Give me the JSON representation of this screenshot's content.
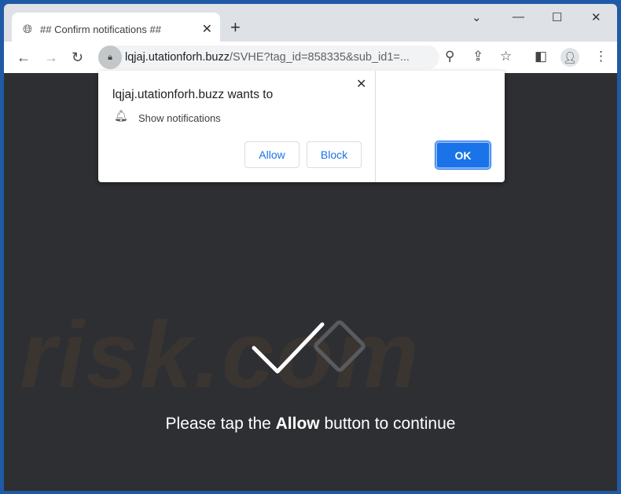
{
  "tab": {
    "title": "## Confirm notifications ##",
    "icon": "globe-icon"
  },
  "address": {
    "domain": "lqjaj.utationforh.buzz",
    "path": "/SVHE?tag_id=858335&sub_id1=..."
  },
  "popup": {
    "heading": "lqjaj.utationforh.buzz wants to",
    "permission": "Show notifications",
    "allow": "Allow",
    "block": "Block",
    "ok": "OK"
  },
  "page": {
    "watermark": "risk.com",
    "message_pre": "Please tap the ",
    "message_bold": "Allow",
    "message_post": " button to continue"
  },
  "colors": {
    "accent": "#1a73e8",
    "page_bg": "#2e2f33",
    "frame": "#dee1e6"
  }
}
